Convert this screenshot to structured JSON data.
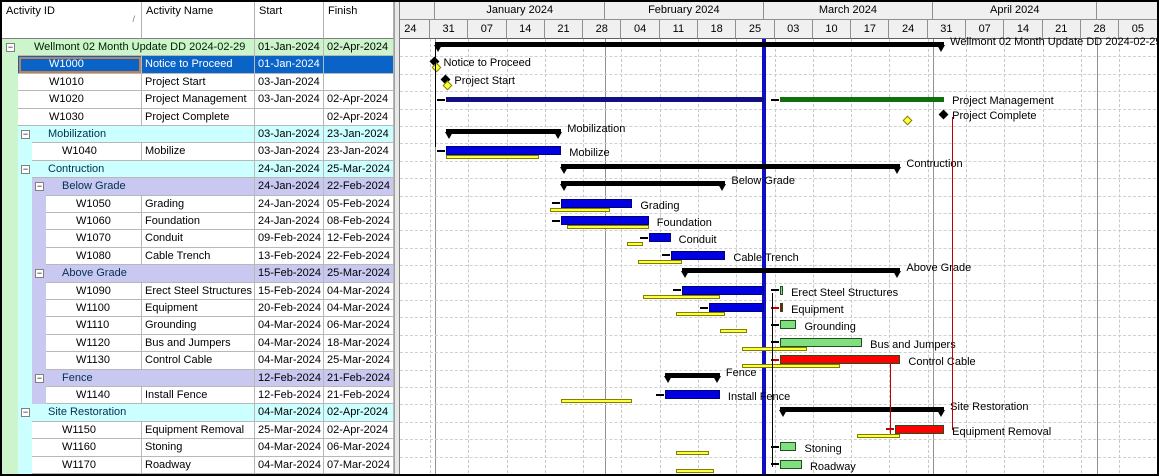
{
  "columns": {
    "activity_id": "Activity ID",
    "activity_name": "Activity Name",
    "start": "Start",
    "finish": "Finish"
  },
  "timescale": {
    "months": [
      "January 2024",
      "February 2024",
      "March 2024",
      "April 2024"
    ],
    "weeks": [
      "24",
      "31",
      "07",
      "14",
      "21",
      "28",
      "04",
      "11",
      "18",
      "25",
      "03",
      "10",
      "17",
      "24",
      "31",
      "07",
      "14",
      "21",
      "28",
      "05"
    ]
  },
  "data_date": "2024-02-29",
  "colors": {
    "project_row": "#ccf5cc",
    "wbs1_row": "#ccffff",
    "wbs2_row": "#c8c8f0",
    "selected_row": "#0a64c8",
    "actual_bar": "#0000e0",
    "remaining_bar": "#80e080",
    "critical_bar": "#ff0000",
    "baseline_bar": "#ffff40",
    "project_mgmt_bar": "#107010",
    "summary_bar": "#000000",
    "data_date_line": "#1010c0"
  },
  "rows": [
    {
      "type": "project",
      "level": 0,
      "id": "",
      "name": "Wellmont 02 Month Update DD 2024-02-29",
      "start": "01-Jan-2024",
      "finish": "02-Apr-2024",
      "gantt": {
        "summary": [
          "2024-01-01",
          "2024-04-02"
        ]
      }
    },
    {
      "type": "task",
      "level": 1,
      "selected": true,
      "id": "W1000",
      "name": "Notice to Proceed",
      "start": "01-Jan-2024",
      "finish": "",
      "gantt": {
        "milestone": "2024-01-01",
        "baseline_milestone": "2024-01-01"
      }
    },
    {
      "type": "task",
      "level": 1,
      "id": "W1010",
      "name": "Project Start",
      "start": "03-Jan-2024",
      "finish": "",
      "gantt": {
        "milestone": "2024-01-03",
        "baseline_milestone": "2024-01-03"
      }
    },
    {
      "type": "task",
      "level": 1,
      "id": "W1020",
      "name": "Project Management",
      "start": "03-Jan-2024",
      "finish": "02-Apr-2024",
      "gantt": {
        "segments": [
          [
            "2024-01-03",
            "2024-02-29",
            "actual_dark"
          ],
          [
            "2024-03-04",
            "2024-04-02",
            "pm"
          ]
        ]
      }
    },
    {
      "type": "task",
      "level": 1,
      "id": "W1030",
      "name": "Project Complete",
      "start": "",
      "finish": "02-Apr-2024",
      "gantt": {
        "milestone": "2024-04-02",
        "baseline_milestone": "2024-03-26"
      }
    },
    {
      "type": "wbs1",
      "level": 1,
      "id": "",
      "name": "Mobilization",
      "start": "03-Jan-2024",
      "finish": "23-Jan-2024",
      "gantt": {
        "summary": [
          "2024-01-03",
          "2024-01-23"
        ]
      }
    },
    {
      "type": "task",
      "level": 2,
      "id": "W1040",
      "name": "Mobilize",
      "start": "03-Jan-2024",
      "finish": "23-Jan-2024",
      "gantt": {
        "segments": [
          [
            "2024-01-03",
            "2024-01-23",
            "actual"
          ]
        ],
        "baseline": [
          "2024-01-03",
          "2024-01-19"
        ]
      }
    },
    {
      "type": "wbs1",
      "level": 1,
      "id": "",
      "name": "Contruction",
      "start": "24-Jan-2024",
      "finish": "25-Mar-2024",
      "gantt": {
        "summary": [
          "2024-01-24",
          "2024-03-25"
        ]
      }
    },
    {
      "type": "wbs2",
      "level": 2,
      "id": "",
      "name": "Below Grade",
      "start": "24-Jan-2024",
      "finish": "22-Feb-2024",
      "gantt": {
        "summary": [
          "2024-01-24",
          "2024-02-22"
        ]
      }
    },
    {
      "type": "task",
      "level": 3,
      "id": "W1050",
      "name": "Grading",
      "start": "24-Jan-2024",
      "finish": "05-Feb-2024",
      "gantt": {
        "segments": [
          [
            "2024-01-24",
            "2024-02-05",
            "actual"
          ]
        ],
        "baseline": [
          "2024-01-22",
          "2024-02-01"
        ]
      }
    },
    {
      "type": "task",
      "level": 3,
      "id": "W1060",
      "name": "Foundation",
      "start": "24-Jan-2024",
      "finish": "08-Feb-2024",
      "gantt": {
        "segments": [
          [
            "2024-01-24",
            "2024-02-08",
            "actual"
          ]
        ],
        "baseline": [
          "2024-01-25",
          "2024-02-08"
        ]
      }
    },
    {
      "type": "task",
      "level": 3,
      "id": "W1070",
      "name": "Conduit",
      "start": "09-Feb-2024",
      "finish": "12-Feb-2024",
      "gantt": {
        "segments": [
          [
            "2024-02-09",
            "2024-02-12",
            "actual"
          ]
        ],
        "baseline": [
          "2024-02-05",
          "2024-02-07"
        ]
      }
    },
    {
      "type": "task",
      "level": 3,
      "id": "W1080",
      "name": "Cable Trench",
      "start": "13-Feb-2024",
      "finish": "22-Feb-2024",
      "gantt": {
        "segments": [
          [
            "2024-02-13",
            "2024-02-22",
            "actual"
          ]
        ],
        "baseline": [
          "2024-02-07",
          "2024-02-14"
        ]
      }
    },
    {
      "type": "wbs2",
      "level": 2,
      "id": "",
      "name": "Above Grade",
      "start": "15-Feb-2024",
      "finish": "25-Mar-2024",
      "gantt": {
        "summary": [
          "2024-02-15",
          "2024-03-25"
        ]
      }
    },
    {
      "type": "task",
      "level": 3,
      "id": "W1090",
      "name": "Erect Steel Structures",
      "start": "15-Feb-2024",
      "finish": "04-Mar-2024",
      "gantt": {
        "segments": [
          [
            "2024-02-15",
            "2024-02-29",
            "actual"
          ],
          [
            "2024-03-04",
            "2024-03-04",
            "remaining_thin"
          ]
        ],
        "baseline": [
          "2024-02-08",
          "2024-02-21"
        ]
      }
    },
    {
      "type": "task",
      "level": 3,
      "id": "W1100",
      "name": "Equipment",
      "start": "20-Feb-2024",
      "finish": "04-Mar-2024",
      "gantt": {
        "segments": [
          [
            "2024-02-20",
            "2024-02-29",
            "actual"
          ],
          [
            "2024-03-04",
            "2024-03-04",
            "critical_thin"
          ]
        ],
        "baseline": [
          "2024-02-14",
          "2024-02-22"
        ]
      }
    },
    {
      "type": "task",
      "level": 3,
      "id": "W1110",
      "name": "Grounding",
      "start": "04-Mar-2024",
      "finish": "06-Mar-2024",
      "gantt": {
        "segments": [
          [
            "2024-03-04",
            "2024-03-06",
            "remaining"
          ]
        ],
        "baseline": [
          "2024-02-22",
          "2024-02-26"
        ]
      }
    },
    {
      "type": "task",
      "level": 3,
      "id": "W1120",
      "name": "Bus and Jumpers",
      "start": "04-Mar-2024",
      "finish": "18-Mar-2024",
      "gantt": {
        "segments": [
          [
            "2024-03-04",
            "2024-03-18",
            "remaining"
          ]
        ],
        "baseline": [
          "2024-02-26",
          "2024-03-08"
        ]
      }
    },
    {
      "type": "task",
      "level": 3,
      "id": "W1130",
      "name": "Control Cable",
      "start": "04-Mar-2024",
      "finish": "25-Mar-2024",
      "gantt": {
        "segments": [
          [
            "2024-03-04",
            "2024-03-25",
            "critical"
          ]
        ],
        "baseline": [
          "2024-02-26",
          "2024-03-14"
        ]
      }
    },
    {
      "type": "wbs2",
      "level": 2,
      "id": "",
      "name": "Fence",
      "start": "12-Feb-2024",
      "finish": "21-Feb-2024",
      "gantt": {
        "summary": [
          "2024-02-12",
          "2024-02-21"
        ]
      }
    },
    {
      "type": "task",
      "level": 3,
      "id": "W1140",
      "name": "Install Fence",
      "start": "12-Feb-2024",
      "finish": "21-Feb-2024",
      "gantt": {
        "segments": [
          [
            "2024-02-12",
            "2024-02-21",
            "actual"
          ]
        ],
        "baseline": [
          "2024-01-24",
          "2024-02-05"
        ]
      }
    },
    {
      "type": "wbs1",
      "level": 1,
      "id": "",
      "name": "Site Restoration",
      "start": "04-Mar-2024",
      "finish": "02-Apr-2024",
      "gantt": {
        "summary": [
          "2024-03-04",
          "2024-04-02"
        ]
      }
    },
    {
      "type": "task",
      "level": 2,
      "id": "W1150",
      "name": "Equipment Removal",
      "start": "25-Mar-2024",
      "finish": "02-Apr-2024",
      "gantt": {
        "segments": [
          [
            "2024-03-25",
            "2024-04-02",
            "critical"
          ]
        ],
        "baseline": [
          "2024-03-18",
          "2024-03-25"
        ]
      }
    },
    {
      "type": "task",
      "level": 2,
      "id": "W1160",
      "name": "Stoning",
      "start": "04-Mar-2024",
      "finish": "06-Mar-2024",
      "gantt": {
        "segments": [
          [
            "2024-03-04",
            "2024-03-06",
            "remaining"
          ]
        ],
        "baseline": [
          "2024-02-14",
          "2024-02-19"
        ]
      }
    },
    {
      "type": "task",
      "level": 2,
      "id": "W1170",
      "name": "Roadway",
      "start": "04-Mar-2024",
      "finish": "07-Mar-2024",
      "gantt": {
        "segments": [
          [
            "2024-03-04",
            "2024-03-07",
            "remaining"
          ]
        ],
        "baseline": [
          "2024-02-14",
          "2024-02-20"
        ]
      }
    }
  ]
}
